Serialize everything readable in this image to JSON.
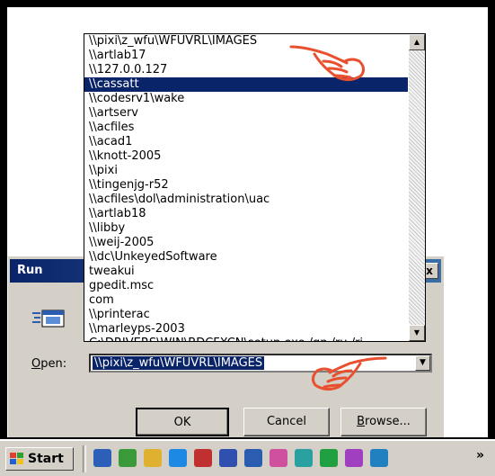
{
  "window": {
    "title": "Run"
  },
  "open_field": {
    "label_underlined": "O",
    "label_rest": "pen:",
    "value": "\\\\pixi\\z_wfu\\WFUVRL\\IMAGES"
  },
  "dropdown": {
    "selected_index": 3,
    "items": [
      "\\\\pixi\\z_wfu\\WFUVRL\\IMAGES",
      "\\\\artlab17",
      "\\\\127.0.0.127",
      "\\\\cassatt",
      "\\\\codesrv1\\wake",
      "\\\\artserv",
      "\\\\acfiles",
      "\\\\acad1",
      "\\\\knott-2005",
      "\\\\pixi",
      "\\\\tingenjg-r52",
      "\\\\acfiles\\dol\\administration\\uac",
      "\\\\artlab18",
      "\\\\libby",
      "\\\\weij-2005",
      "\\\\dc\\UnkeyedSoftware",
      "tweakui",
      "gpedit.msc",
      "com",
      "\\\\printerac",
      "\\\\marleyps-2003",
      "C:\\DRIVERS\\WIN\\BDCFXCN\\setup.exe /qn /ru /ri"
    ]
  },
  "buttons": {
    "ok": "OK",
    "cancel": "Cancel",
    "browse_underlined": "B",
    "browse_rest": "rowse..."
  },
  "close_glyph": "x",
  "taskbar": {
    "start_label": "Start",
    "overflow_glyph": "»",
    "quicklaunch_icons": [
      {
        "name": "ql-icon-1",
        "color": "#2b5fb8"
      },
      {
        "name": "ql-icon-2",
        "color": "#3a9a3a"
      },
      {
        "name": "ql-icon-3",
        "color": "#e0b030"
      },
      {
        "name": "ql-icon-4",
        "color": "#1e88e5"
      },
      {
        "name": "ql-icon-5",
        "color": "#c03030"
      },
      {
        "name": "ql-icon-6",
        "color": "#3050b0"
      },
      {
        "name": "ql-icon-7",
        "color": "#2a5db0"
      },
      {
        "name": "ql-icon-8",
        "color": "#d050a0"
      },
      {
        "name": "ql-icon-9",
        "color": "#2aa0a0"
      },
      {
        "name": "ql-icon-10",
        "color": "#20a040"
      },
      {
        "name": "ql-icon-11",
        "color": "#a040c0"
      },
      {
        "name": "ql-icon-12",
        "color": "#2080c0"
      }
    ]
  },
  "colors": {
    "titlebar": "#0a246a",
    "selection": "#0a246a",
    "hand": "#e85030",
    "dialog_face": "#d4d0c8"
  }
}
